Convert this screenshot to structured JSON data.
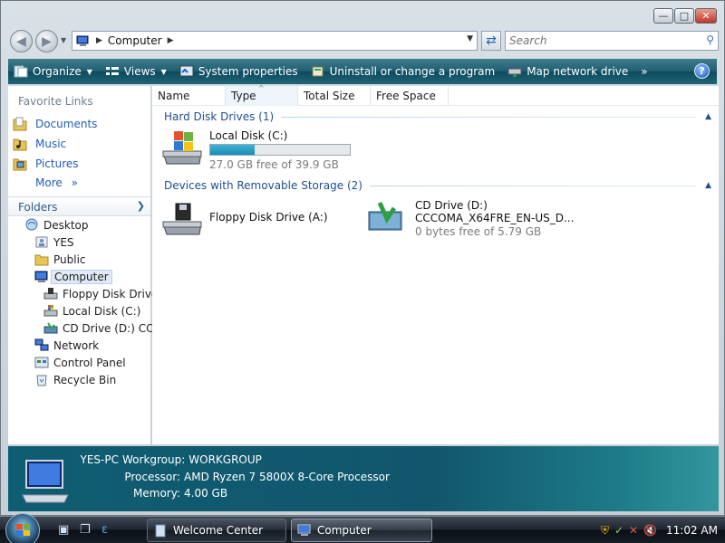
{
  "window": {
    "caption_buttons": [
      "minimize-icon",
      "maximize-icon",
      "close-icon"
    ]
  },
  "nav": {
    "address_location": "Computer",
    "search_placeholder": "Search"
  },
  "toolbar": {
    "organize": "Organize",
    "views": "Views",
    "system_properties": "System properties",
    "uninstall": "Uninstall or change a program",
    "map_network_drive": "Map network drive",
    "more": "»",
    "help": "?"
  },
  "leftpane": {
    "favorite_links_title": "Favorite Links",
    "favorites": [
      {
        "label": "Documents",
        "icon": "documents-icon"
      },
      {
        "label": "Music",
        "icon": "music-icon"
      },
      {
        "label": "Pictures",
        "icon": "pictures-icon"
      }
    ],
    "more": "More",
    "more_chevron": "»",
    "folders_title": "Folders",
    "tree": [
      {
        "label": "Desktop",
        "icon": "desktop-icon"
      },
      {
        "label": "YES",
        "icon": "user-folder-icon"
      },
      {
        "label": "Public",
        "icon": "public-folder-icon"
      },
      {
        "label": "Computer",
        "icon": "computer-icon"
      },
      {
        "label": "Floppy Disk Drive",
        "icon": "floppy-drive-icon"
      },
      {
        "label": "Local Disk (C:)",
        "icon": "local-disk-icon"
      },
      {
        "label": "CD Drive (D:) CCC",
        "icon": "cd-drive-icon"
      },
      {
        "label": "Network",
        "icon": "network-icon"
      },
      {
        "label": "Control Panel",
        "icon": "control-panel-icon"
      },
      {
        "label": "Recycle Bin",
        "icon": "recycle-bin-icon"
      }
    ]
  },
  "columns": [
    "Name",
    "Type",
    "Total Size",
    "Free Space"
  ],
  "groups": {
    "hard_disks": "Hard Disk Drives (1)",
    "removable": "Devices with Removable Storage (2)"
  },
  "drives": {
    "local_disk": {
      "name": "Local Disk (C:)",
      "free": "27.0 GB free of 39.9 GB",
      "used_fraction": 0.32
    },
    "floppy": {
      "name": "Floppy Disk Drive (A:)"
    },
    "cd": {
      "name": "CD Drive (D:)",
      "label": "CCCOMA_X64FRE_EN-US_D...",
      "free": "0 bytes free of 5.79 GB"
    }
  },
  "details": {
    "pc_name": "YES-PC",
    "workgroup_key": "Workgroup:",
    "workgroup_val": "WORKGROUP",
    "processor_key": "Processor:",
    "processor_val": "AMD Ryzen 7 5800X 8-Core Processor",
    "memory_key": "Memory:",
    "memory_val": "4.00 GB"
  },
  "taskbar": {
    "tasks": [
      "Welcome Center",
      "Computer"
    ],
    "clock": "11:02 AM"
  }
}
